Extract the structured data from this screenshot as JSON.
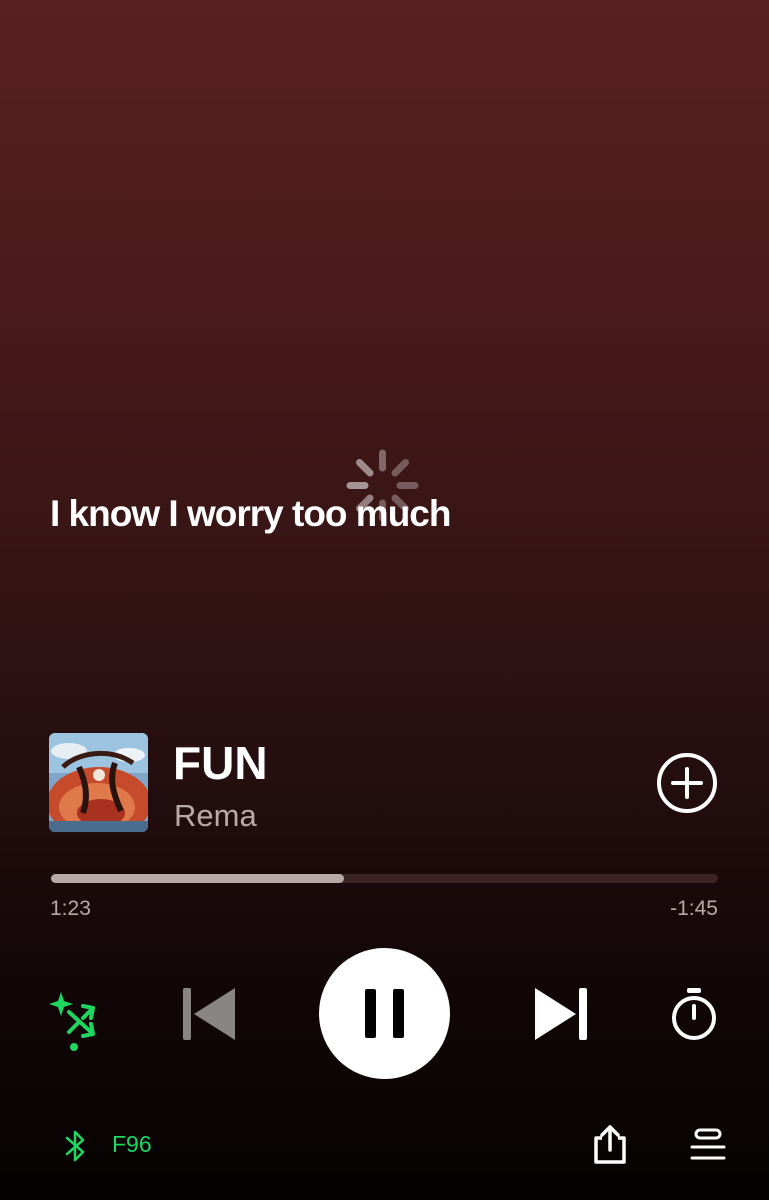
{
  "lyrics": {
    "current_line": "I know I worry too much"
  },
  "loading_indicator": "spinner-icon",
  "now_playing": {
    "title": "FUN",
    "artist": "Rema",
    "artwork": "album-artwork"
  },
  "progress": {
    "elapsed": "1:23",
    "remaining": "-1:45",
    "fraction": 0.44
  },
  "controls": {
    "smart_shuffle": "smart-shuffle-icon",
    "previous": "skip-previous-icon",
    "play_pause": "pause-icon",
    "next": "skip-next-icon",
    "sleep_timer": "timer-icon"
  },
  "device": {
    "icon": "bluetooth-icon",
    "name": "F96"
  },
  "footer": {
    "share": "share-icon",
    "queue": "queue-icon"
  },
  "colors": {
    "accent_green": "#1ed760",
    "text_secondary": "#b8a9a9",
    "background_top": "#5a1f1f",
    "background_bottom": "#050202"
  }
}
